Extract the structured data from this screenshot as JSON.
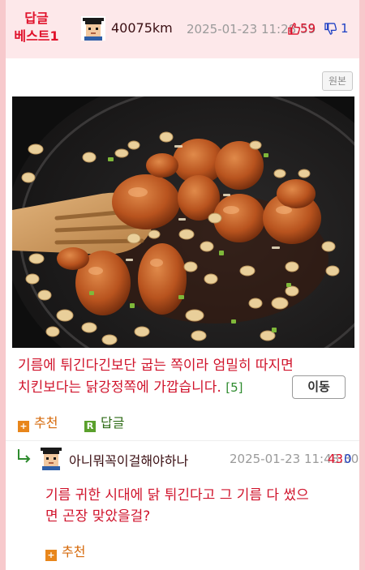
{
  "best": {
    "line1": "답글",
    "line2": "베스트1"
  },
  "comment": {
    "author": "40075km",
    "timestamp": "2025-01-23 11:28:59",
    "upvotes": "59",
    "downvotes": "1",
    "original_label": "원본",
    "text_line1": "기름에 튀긴다긴보단 굽는 쪽이라 엄밀히 따지면",
    "text_line2": "치킨보다는 닭강정쪽에 가깝습니다.",
    "reply_count": "[5]",
    "move_label": "이동",
    "recommend_label": "추천",
    "reply_label": "답글",
    "recommend_icon_glyph": "+",
    "reply_icon_glyph": "R"
  },
  "reply": {
    "author": "아니뭐꼭이걸해야하나",
    "timestamp": "2025-01-23 11:48:30",
    "upvotes": "43",
    "downvotes": "0",
    "text_line1": "기름 귀한 시대에 닭 튀긴다고 그 기름 다 썼으",
    "text_line2": "면 곤장 맞았을걸?",
    "recommend_label": "추천",
    "recommend_icon_glyph": "+"
  },
  "colors": {
    "accent_red": "#e0112b",
    "downvote_blue": "#1d3fc4",
    "header_pink": "#fde8ea",
    "page_border": "#f7c9cc",
    "recommend_orange": "#e8861b",
    "reply_green": "#5aa02c"
  }
}
